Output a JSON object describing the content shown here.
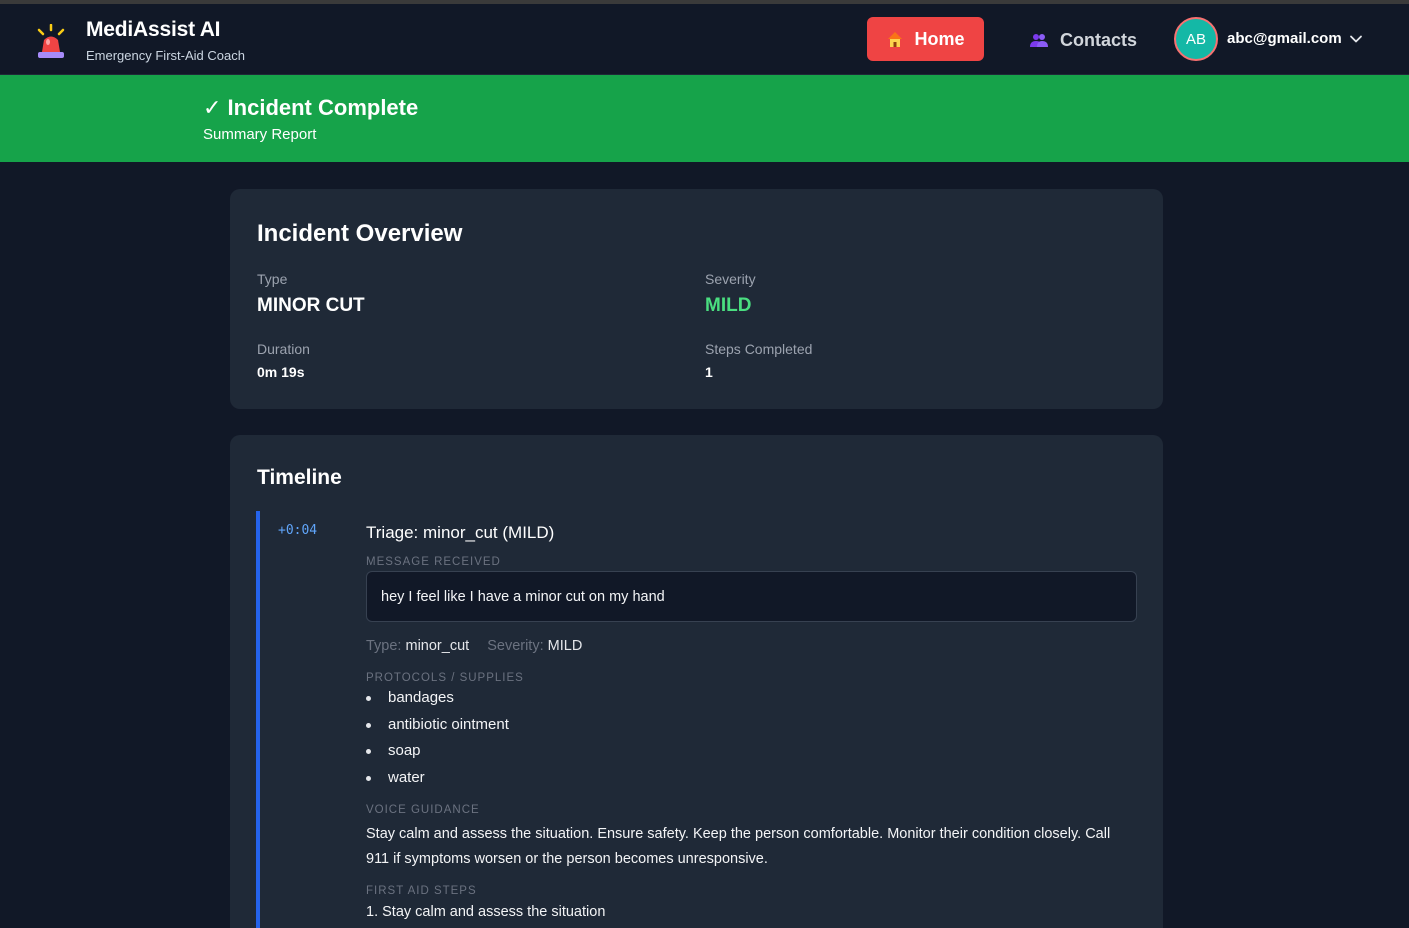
{
  "app": {
    "title": "MediAssist AI",
    "subtitle": "Emergency First-Aid Coach",
    "icon": "siren-icon"
  },
  "nav": {
    "home_label": "Home",
    "home_icon": "house-icon",
    "contacts_label": "Contacts",
    "contacts_icon": "people-icon",
    "avatar_initials": "AB",
    "user_email": "abc@gmail.com"
  },
  "banner": {
    "title": "✓ Incident Complete",
    "subtitle": "Summary Report",
    "color": "#16a34a"
  },
  "overview": {
    "title": "Incident Overview",
    "type_label": "Type",
    "type_value": "MINOR CUT",
    "severity_label": "Severity",
    "severity_value": "MILD",
    "duration_label": "Duration",
    "duration_value": "0m 19s",
    "steps_label": "Steps Completed",
    "steps_value": "1"
  },
  "timeline": {
    "title": "Timeline",
    "entries": [
      {
        "time": "+0:04",
        "heading": "Triage: minor_cut (MILD)",
        "message_label": "MESSAGE RECEIVED",
        "message": "hey I feel like I have a minor cut on my hand",
        "type_key": "Type:",
        "type_val": "minor_cut",
        "severity_key": "Severity:",
        "severity_val": "MILD",
        "protocols_label": "PROTOCOLS / SUPPLIES",
        "supplies": [
          "bandages",
          "antibiotic ointment",
          "soap",
          "water"
        ],
        "voice_label": "VOICE GUIDANCE",
        "voice": "Stay calm and assess the situation. Ensure safety. Keep the person comfortable. Monitor their condition closely. Call 911 if symptoms worsen or the person becomes unresponsive.",
        "steps_label": "FIRST AID STEPS",
        "steps": [
          "1. Stay calm and assess the situation"
        ]
      }
    ]
  },
  "colors": {
    "background": "#111827",
    "card": "#1f2937",
    "accent_red": "#ef4444",
    "accent_blue": "#2563eb",
    "mild_green": "#4ade80"
  }
}
